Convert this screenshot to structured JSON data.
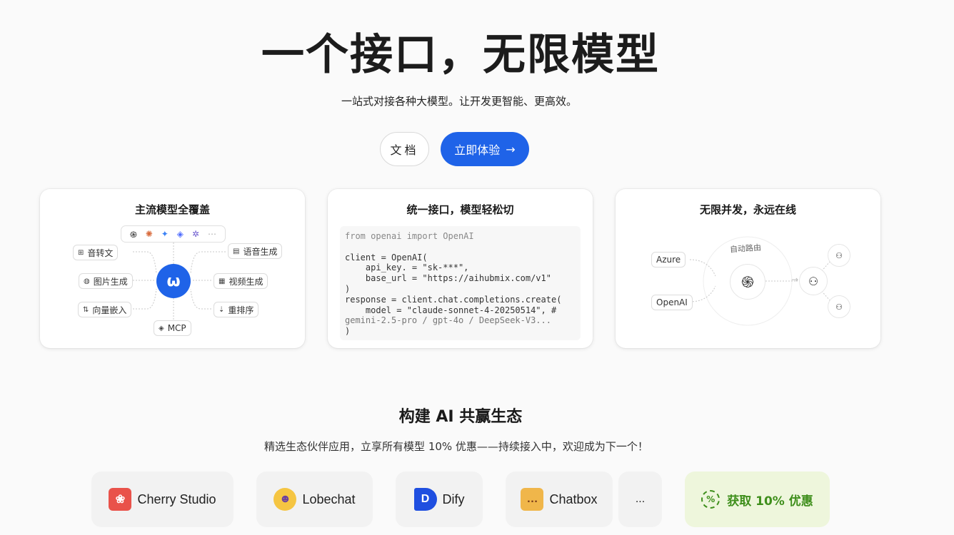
{
  "hero": {
    "title": "一个接口，无限模型",
    "subtitle": "一站式对接各种大模型。让开发更智能、更高效。",
    "docs_label": "文档",
    "try_label": "立即体验",
    "try_arrow": "→"
  },
  "card1": {
    "title": "主流模型全覆盖",
    "model_icons": [
      "֍",
      "✺",
      "✦",
      "◈",
      "✲",
      "⋯"
    ],
    "hub_glyph": "ω",
    "chips": {
      "speech_to_text": "音转文",
      "image_gen": "图片生成",
      "vector_embed": "向量嵌入",
      "tts": "语音生成",
      "video_gen": "视频生成",
      "rerank": "重排序",
      "mcp": "MCP"
    }
  },
  "card2": {
    "title": "统一接口，模型轻松切",
    "code": {
      "l1a": "from",
      "l1b": " openai ",
      "l1c": "import",
      "l1d": " OpenAI",
      "l2": "client = OpenAI(",
      "l3": "    api_key. = \"sk-***\",",
      "l4": "    base_url = \"https://aihubmix.com/v1\"",
      "l5": ")",
      "l6": "response = client.chat.completions.create(",
      "l7": "    model = \"claude-sonnet-4-20250514\", #",
      "l8": "gemini-2.5-pro / gpt-4o / DeepSeek-V3...",
      "l9": ")"
    }
  },
  "card3": {
    "title": "无限并发，永远在线",
    "auto_route": "自动路由",
    "azure": "Azure",
    "openai": "OpenAI",
    "center_glyph": "֍",
    "users_glyph": "⚇",
    "user_glyph": "⚇",
    "arrow": "→"
  },
  "ecosystem": {
    "title": "构建 AI 共赢生态",
    "subtitle": "精选生态伙伴应用，立享所有模型 10% 优惠——持续接入中，欢迎成为下一个！",
    "partners": [
      {
        "name": "Cherry Studio",
        "glyph": "❀"
      },
      {
        "name": "Lobechat",
        "glyph": "☻"
      },
      {
        "name": "Dify",
        "glyph": "D"
      },
      {
        "name": "Chatbox",
        "glyph": "…"
      }
    ],
    "more": "...",
    "discount_label": "获取 10% 优惠",
    "discount_icon": "%"
  }
}
